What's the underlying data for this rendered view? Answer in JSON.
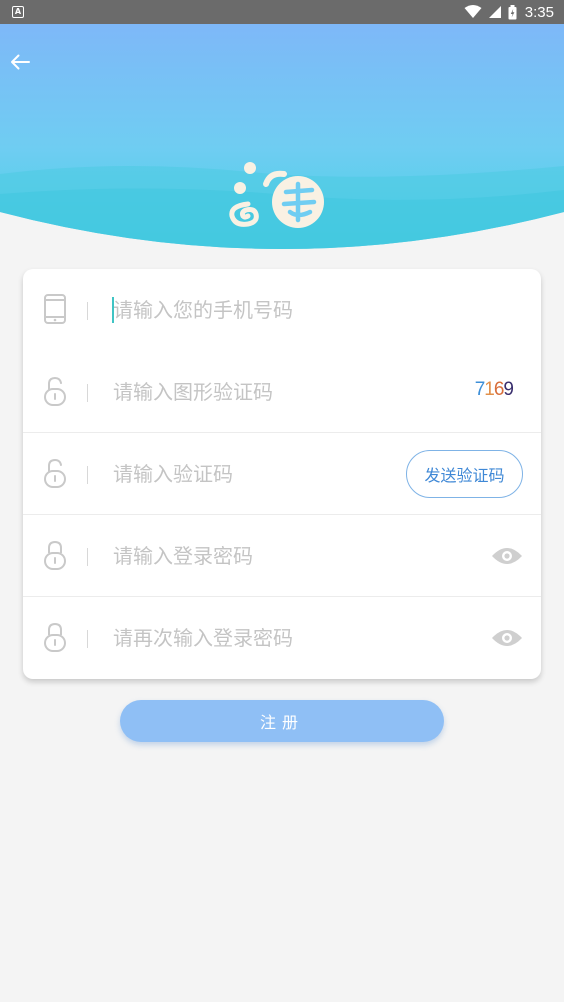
{
  "status_bar": {
    "notification_icon": "A",
    "time": "3:35",
    "icons": [
      "wifi-icon",
      "signal-icon",
      "battery-icon"
    ]
  },
  "header": {
    "back_icon": "arrow-left-icon",
    "logo_icon": "hai-logo-icon",
    "gradient_top": "#7fb9f7",
    "gradient_bottom": "#4fd3e8"
  },
  "form": {
    "phone": {
      "placeholder": "请输入您的手机号码",
      "icon": "phone-icon"
    },
    "image_captcha": {
      "placeholder": "请输入图形验证码",
      "icon": "unlock-icon",
      "captcha_digits": [
        "7",
        "1",
        "6",
        "9"
      ]
    },
    "sms_code": {
      "placeholder": "请输入验证码",
      "icon": "unlock-icon",
      "send_label": "发送验证码"
    },
    "password": {
      "placeholder": "请输入登录密码",
      "icon": "lock-icon",
      "toggle_icon": "eye-icon"
    },
    "confirm_password": {
      "placeholder": "请再次输入登录密码",
      "icon": "lock-icon",
      "toggle_icon": "eye-icon"
    }
  },
  "register_label": "注册",
  "colors": {
    "accent": "#8fbff5",
    "send_button_text": "#3f88d6",
    "placeholder": "#c4c4c4",
    "background": "#f4f4f4"
  }
}
